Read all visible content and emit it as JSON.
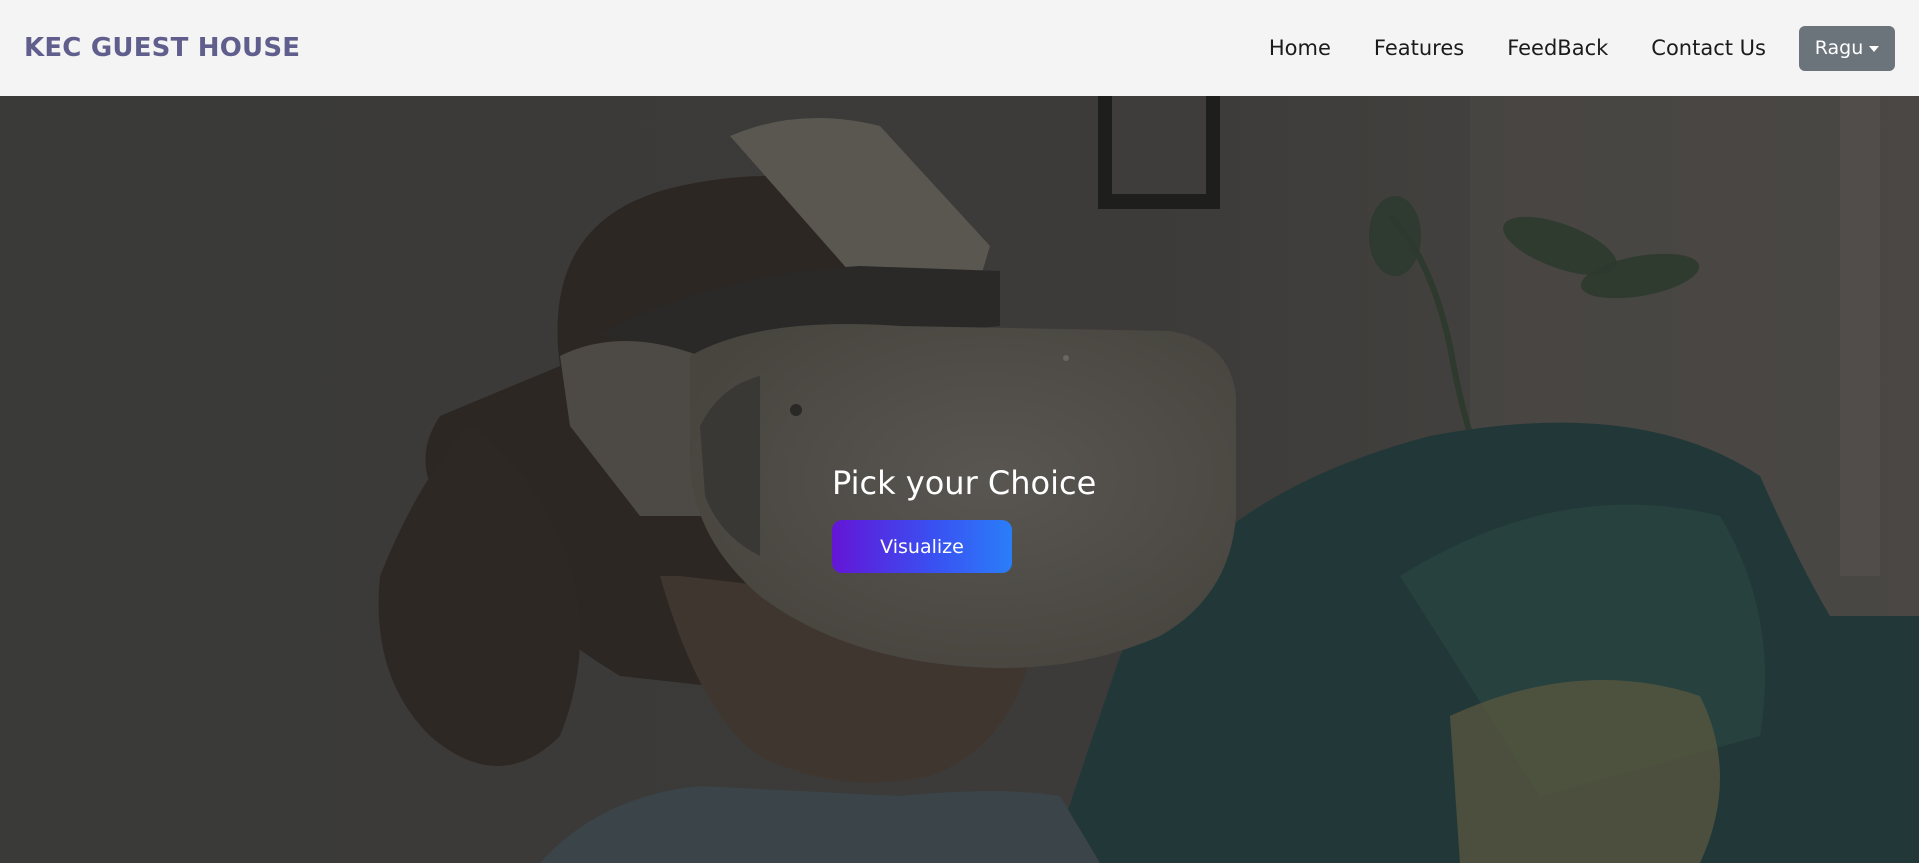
{
  "navbar": {
    "brand": "KEC GUEST HOUSE",
    "links": [
      {
        "label": "Home"
      },
      {
        "label": "Features"
      },
      {
        "label": "FeedBack"
      },
      {
        "label": "Contact Us"
      }
    ],
    "user_menu": {
      "label": "Ragu"
    }
  },
  "hero": {
    "title": "Pick your Choice",
    "button_label": "Visualize"
  },
  "colors": {
    "brand": "#5f5e8c",
    "navbar_bg": "#f4f4f4",
    "user_menu_bg": "#6b737b",
    "button_gradient_start": "#6415d6",
    "button_gradient_end": "#2a7ef9"
  },
  "icons": [
    "caret-down-icon"
  ]
}
